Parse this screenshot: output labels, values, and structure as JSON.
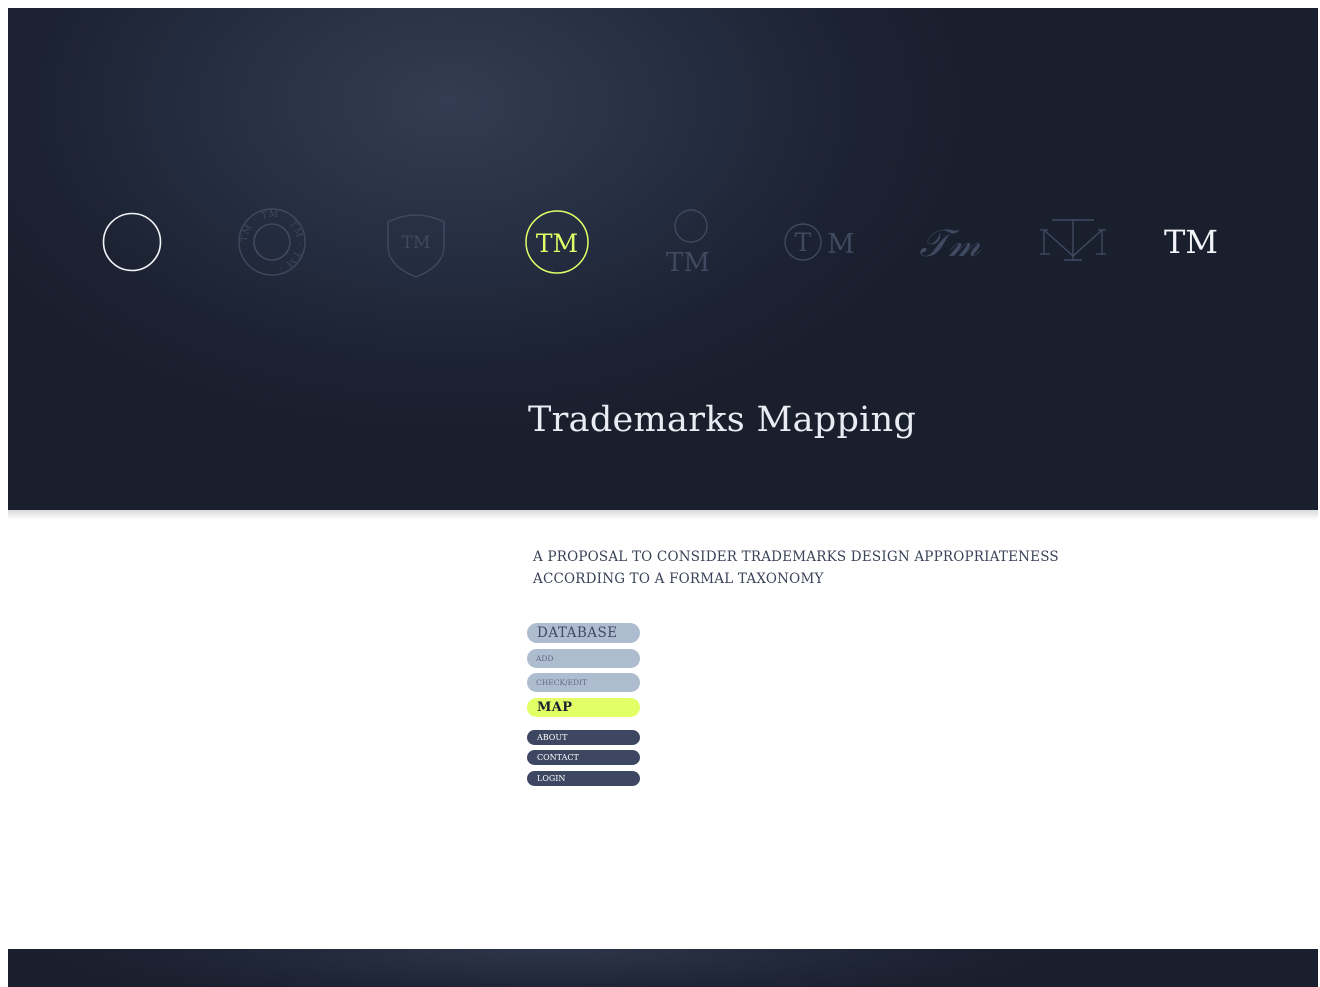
{
  "hero": {
    "title": "Trademarks Mapping",
    "accent_color": "#e2ff66",
    "background_color": "#1c2232",
    "icons": [
      {
        "name": "circle-icon",
        "state": "selected-outline"
      },
      {
        "name": "circular-seal-icon",
        "text": "TM · TM · TM · TM ·",
        "state": "dim"
      },
      {
        "name": "shield-icon",
        "text": "TM",
        "state": "dim"
      },
      {
        "name": "circled-tm-icon",
        "text": "TM",
        "state": "highlighted"
      },
      {
        "name": "circle-above-tm-icon",
        "text": "TM",
        "state": "dim"
      },
      {
        "name": "circled-t-m-icon",
        "text_circle": "T",
        "text_after": "M",
        "state": "dim"
      },
      {
        "name": "script-tm-icon",
        "text": "𝒯𝓂",
        "state": "dim"
      },
      {
        "name": "monogram-tm-icon",
        "state": "dim"
      },
      {
        "name": "plain-tm-icon",
        "text": "TM",
        "state": "bright"
      }
    ]
  },
  "main": {
    "tagline_line1": "A PROPOSAL TO CONSIDER TRADEMARKS DESIGN APPROPRIATENESS",
    "tagline_line2": "ACCORDING TO A FORMAL TAXONOMY"
  },
  "nav": {
    "database": "DATABASE",
    "add": "ADD",
    "check_edit": "CHECK/EDIT",
    "map": "MAP",
    "about": "ABOUT",
    "contact": "CONTACT",
    "login": "LOGIN"
  }
}
